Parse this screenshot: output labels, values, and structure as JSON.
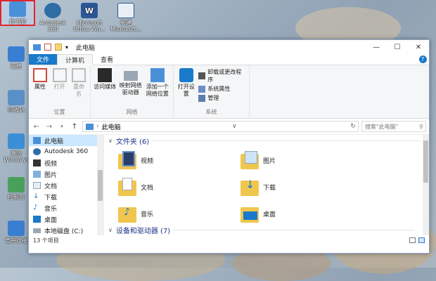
{
  "desktop": {
    "icons": [
      {
        "label": "此电脑",
        "selected": true,
        "color": "#4a90d9"
      },
      {
        "label": "Autodesk 360",
        "color": "#2e6da4"
      },
      {
        "label": "Microsoft Office Wo...",
        "color": "#2b5797"
      },
      {
        "label": "新建 Microsoft...",
        "color": "#2b5797"
      },
      {
        "label": "网络",
        "color": "#3a7ed1"
      },
      {
        "label": "回收站",
        "color": "#5b8fc7"
      },
      {
        "label": "激活 Windows",
        "color": "#3b8fd6"
      },
      {
        "label": "控制面",
        "color": "#4aa05a"
      },
      {
        "label": "宽带连接",
        "color": "#3a7ed1"
      }
    ]
  },
  "window": {
    "title": "此电脑",
    "tabs": [
      "文件",
      "计算机",
      "查看"
    ],
    "ribbon": {
      "location": {
        "label": "位置",
        "buttons": [
          "属性",
          "打开",
          "重命名"
        ]
      },
      "network": {
        "label": "网络",
        "buttons": [
          "访问媒体",
          "映射网络驱动器",
          "添加一个网络位置"
        ]
      },
      "system": {
        "label": "系统",
        "open_settings": "打开设置",
        "small": [
          "卸载或更改程序",
          "系统属性",
          "管理"
        ]
      }
    },
    "address": {
      "path": "此电脑",
      "search_placeholder": "搜索\"此电脑\""
    },
    "nav": [
      {
        "label": "此电脑",
        "icon": "computer-icon",
        "selected": true
      },
      {
        "label": "Autodesk 360",
        "icon": "autodesk-icon"
      },
      {
        "label": "视频",
        "icon": "video-icon"
      },
      {
        "label": "图片",
        "icon": "picture-icon"
      },
      {
        "label": "文档",
        "icon": "document-icon"
      },
      {
        "label": "下载",
        "icon": "download-icon"
      },
      {
        "label": "音乐",
        "icon": "music-icon"
      },
      {
        "label": "桌面",
        "icon": "desktop-icon"
      },
      {
        "label": "本地磁盘 (C:)",
        "icon": "drive-icon"
      }
    ],
    "sections": {
      "folders_title": "文件夹 (6)",
      "devices_title": "设备和驱动器 (7)"
    },
    "folders": [
      {
        "label": "视频",
        "icon": "video-folder-icon"
      },
      {
        "label": "图片",
        "icon": "picture-folder-icon"
      },
      {
        "label": "文档",
        "icon": "document-folder-icon"
      },
      {
        "label": "下载",
        "icon": "download-folder-icon"
      },
      {
        "label": "音乐",
        "icon": "music-folder-icon"
      },
      {
        "label": "桌面",
        "icon": "desktop-folder-icon"
      }
    ],
    "status": "13 个项目"
  }
}
